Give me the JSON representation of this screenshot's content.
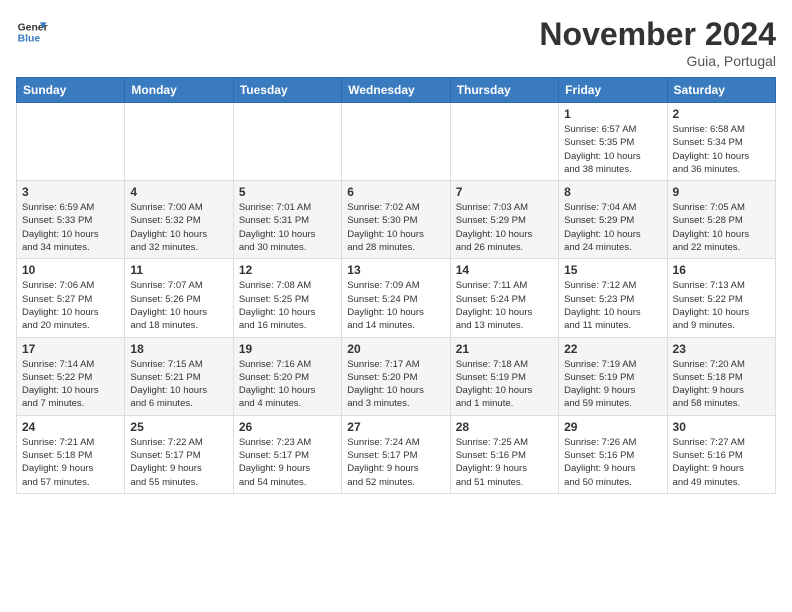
{
  "logo": {
    "line1": "General",
    "line2": "Blue"
  },
  "title": "November 2024",
  "location": "Guia, Portugal",
  "days_of_week": [
    "Sunday",
    "Monday",
    "Tuesday",
    "Wednesday",
    "Thursday",
    "Friday",
    "Saturday"
  ],
  "weeks": [
    [
      {
        "day": "",
        "info": ""
      },
      {
        "day": "",
        "info": ""
      },
      {
        "day": "",
        "info": ""
      },
      {
        "day": "",
        "info": ""
      },
      {
        "day": "",
        "info": ""
      },
      {
        "day": "1",
        "info": "Sunrise: 6:57 AM\nSunset: 5:35 PM\nDaylight: 10 hours\nand 38 minutes."
      },
      {
        "day": "2",
        "info": "Sunrise: 6:58 AM\nSunset: 5:34 PM\nDaylight: 10 hours\nand 36 minutes."
      }
    ],
    [
      {
        "day": "3",
        "info": "Sunrise: 6:59 AM\nSunset: 5:33 PM\nDaylight: 10 hours\nand 34 minutes."
      },
      {
        "day": "4",
        "info": "Sunrise: 7:00 AM\nSunset: 5:32 PM\nDaylight: 10 hours\nand 32 minutes."
      },
      {
        "day": "5",
        "info": "Sunrise: 7:01 AM\nSunset: 5:31 PM\nDaylight: 10 hours\nand 30 minutes."
      },
      {
        "day": "6",
        "info": "Sunrise: 7:02 AM\nSunset: 5:30 PM\nDaylight: 10 hours\nand 28 minutes."
      },
      {
        "day": "7",
        "info": "Sunrise: 7:03 AM\nSunset: 5:29 PM\nDaylight: 10 hours\nand 26 minutes."
      },
      {
        "day": "8",
        "info": "Sunrise: 7:04 AM\nSunset: 5:29 PM\nDaylight: 10 hours\nand 24 minutes."
      },
      {
        "day": "9",
        "info": "Sunrise: 7:05 AM\nSunset: 5:28 PM\nDaylight: 10 hours\nand 22 minutes."
      }
    ],
    [
      {
        "day": "10",
        "info": "Sunrise: 7:06 AM\nSunset: 5:27 PM\nDaylight: 10 hours\nand 20 minutes."
      },
      {
        "day": "11",
        "info": "Sunrise: 7:07 AM\nSunset: 5:26 PM\nDaylight: 10 hours\nand 18 minutes."
      },
      {
        "day": "12",
        "info": "Sunrise: 7:08 AM\nSunset: 5:25 PM\nDaylight: 10 hours\nand 16 minutes."
      },
      {
        "day": "13",
        "info": "Sunrise: 7:09 AM\nSunset: 5:24 PM\nDaylight: 10 hours\nand 14 minutes."
      },
      {
        "day": "14",
        "info": "Sunrise: 7:11 AM\nSunset: 5:24 PM\nDaylight: 10 hours\nand 13 minutes."
      },
      {
        "day": "15",
        "info": "Sunrise: 7:12 AM\nSunset: 5:23 PM\nDaylight: 10 hours\nand 11 minutes."
      },
      {
        "day": "16",
        "info": "Sunrise: 7:13 AM\nSunset: 5:22 PM\nDaylight: 10 hours\nand 9 minutes."
      }
    ],
    [
      {
        "day": "17",
        "info": "Sunrise: 7:14 AM\nSunset: 5:22 PM\nDaylight: 10 hours\nand 7 minutes."
      },
      {
        "day": "18",
        "info": "Sunrise: 7:15 AM\nSunset: 5:21 PM\nDaylight: 10 hours\nand 6 minutes."
      },
      {
        "day": "19",
        "info": "Sunrise: 7:16 AM\nSunset: 5:20 PM\nDaylight: 10 hours\nand 4 minutes."
      },
      {
        "day": "20",
        "info": "Sunrise: 7:17 AM\nSunset: 5:20 PM\nDaylight: 10 hours\nand 3 minutes."
      },
      {
        "day": "21",
        "info": "Sunrise: 7:18 AM\nSunset: 5:19 PM\nDaylight: 10 hours\nand 1 minute."
      },
      {
        "day": "22",
        "info": "Sunrise: 7:19 AM\nSunset: 5:19 PM\nDaylight: 9 hours\nand 59 minutes."
      },
      {
        "day": "23",
        "info": "Sunrise: 7:20 AM\nSunset: 5:18 PM\nDaylight: 9 hours\nand 58 minutes."
      }
    ],
    [
      {
        "day": "24",
        "info": "Sunrise: 7:21 AM\nSunset: 5:18 PM\nDaylight: 9 hours\nand 57 minutes."
      },
      {
        "day": "25",
        "info": "Sunrise: 7:22 AM\nSunset: 5:17 PM\nDaylight: 9 hours\nand 55 minutes."
      },
      {
        "day": "26",
        "info": "Sunrise: 7:23 AM\nSunset: 5:17 PM\nDaylight: 9 hours\nand 54 minutes."
      },
      {
        "day": "27",
        "info": "Sunrise: 7:24 AM\nSunset: 5:17 PM\nDaylight: 9 hours\nand 52 minutes."
      },
      {
        "day": "28",
        "info": "Sunrise: 7:25 AM\nSunset: 5:16 PM\nDaylight: 9 hours\nand 51 minutes."
      },
      {
        "day": "29",
        "info": "Sunrise: 7:26 AM\nSunset: 5:16 PM\nDaylight: 9 hours\nand 50 minutes."
      },
      {
        "day": "30",
        "info": "Sunrise: 7:27 AM\nSunset: 5:16 PM\nDaylight: 9 hours\nand 49 minutes."
      }
    ]
  ]
}
